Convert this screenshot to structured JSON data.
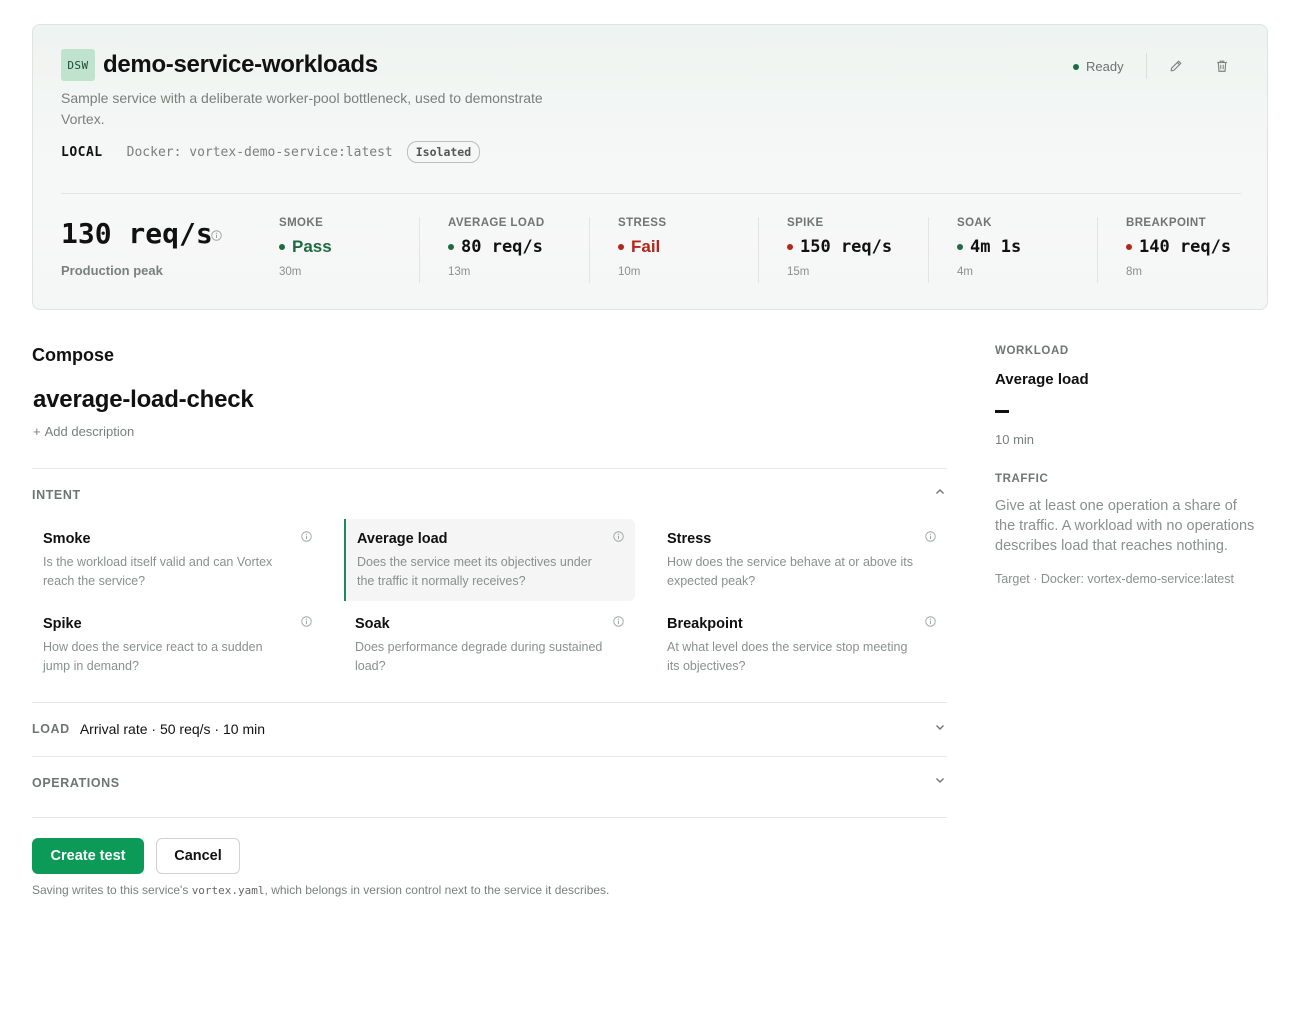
{
  "service": {
    "badge": "DSW",
    "name": "demo-service-workloads",
    "description": "Sample service with a deliberate worker-pool bottleneck, used to demonstrate Vortex.",
    "environment": "LOCAL",
    "target": "Docker: vortex-demo-service:latest",
    "tag": "Isolated",
    "status": "Ready",
    "icons": [
      "pencil-icon",
      "trash-icon"
    ]
  },
  "summary": {
    "peak_value": "130 req/s",
    "peak_label": "Production peak",
    "metrics": [
      {
        "label": "SMOKE",
        "value": "Pass",
        "sub": "30m",
        "status": "pass"
      },
      {
        "label": "AVERAGE LOAD",
        "value": "80 req/s",
        "sub": "13m",
        "status": "pass"
      },
      {
        "label": "STRESS",
        "value": "Fail",
        "sub": "10m",
        "status": "fail"
      },
      {
        "label": "SPIKE",
        "value": "150 req/s",
        "sub": "15m",
        "status": "fail"
      },
      {
        "label": "SOAK",
        "value": "4m 1s",
        "sub": "4m",
        "status": "pass"
      },
      {
        "label": "BREAKPOINT",
        "value": "140 req/s",
        "sub": "8m",
        "status": "fail"
      }
    ]
  },
  "compose": {
    "heading": "Compose",
    "test_name": "average-load-check",
    "add_description": "Add description",
    "intent": {
      "label": "INTENT",
      "options": [
        {
          "title": "Smoke",
          "description": "Is the workload itself valid and can Vortex reach the service?",
          "selected": false
        },
        {
          "title": "Average load",
          "description": "Does the service meet its objectives under the traffic it normally receives?",
          "selected": true
        },
        {
          "title": "Stress",
          "description": "How does the service behave at or above its expected peak?",
          "selected": false
        },
        {
          "title": "Spike",
          "description": "How does the service react to a sudden jump in demand?",
          "selected": false
        },
        {
          "title": "Soak",
          "description": "Does performance degrade during sustained load?",
          "selected": false
        },
        {
          "title": "Breakpoint",
          "description": "At what level does the service stop meeting its objectives?",
          "selected": false
        }
      ]
    },
    "load": {
      "label": "LOAD",
      "summary": "Arrival rate · 50 req/s · 10 min"
    },
    "operations": {
      "label": "OPERATIONS"
    },
    "create_button": "Create test",
    "cancel_button": "Cancel",
    "save_note_prefix": "Saving writes to this service's ",
    "save_note_file": "vortex.yaml",
    "save_note_suffix": ", which belongs in version control next to the service it describes."
  },
  "panel": {
    "workload_label": "WORKLOAD",
    "workload_value": "Average load",
    "duration": "10 min",
    "traffic_label": "TRAFFIC",
    "traffic_text": "Give at least one operation a share of the traffic. A workload with no operations describes load that reaches nothing.",
    "target": "Target · Docker: vortex-demo-service:latest"
  },
  "colors": {
    "accent": "#0c9a58",
    "pass": "#1d6b43",
    "fail": "#b3261e"
  }
}
